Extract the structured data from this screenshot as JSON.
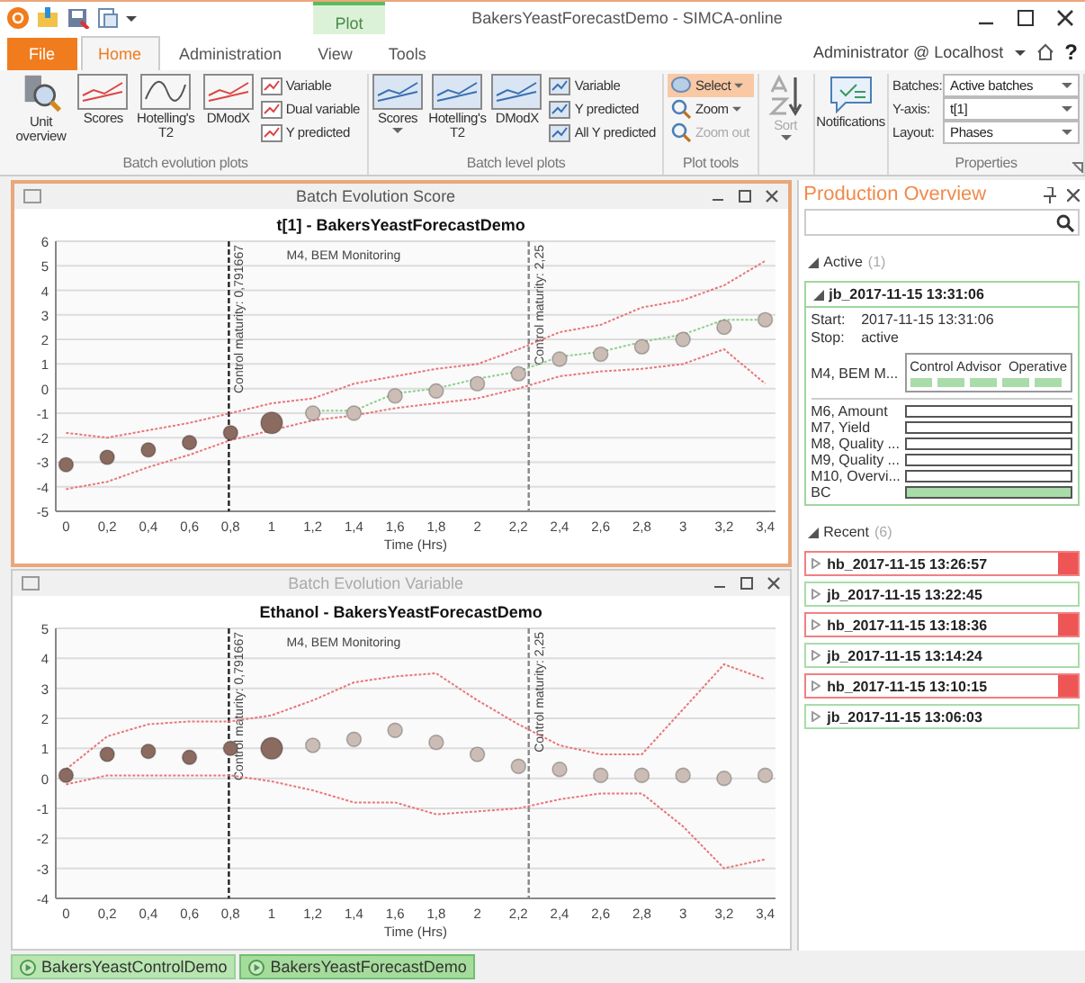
{
  "window": {
    "title": "BakersYeastForecastDemo - SIMCA-online",
    "context_tab": "Plot"
  },
  "tabs": [
    {
      "label": "File",
      "kind": "file",
      "selected": false
    },
    {
      "label": "Home",
      "kind": "tab",
      "selected": true
    },
    {
      "label": "Administration",
      "kind": "tab",
      "selected": false
    },
    {
      "label": "View",
      "kind": "tab",
      "selected": false
    },
    {
      "label": "Tools",
      "kind": "tab",
      "selected": false
    }
  ],
  "user": "Administrator @ Localhost",
  "help": "?",
  "ribbon": [
    {
      "label": "Batch evolution plots",
      "items": [
        {
          "kind": "large",
          "label": "Unit overview"
        },
        {
          "kind": "large",
          "label": "Scores"
        },
        {
          "kind": "large",
          "label": "Hotelling's T2"
        },
        {
          "kind": "large",
          "label": "DModX"
        },
        {
          "kind": "small",
          "label": "Variable"
        },
        {
          "kind": "small",
          "label": "Dual variable"
        },
        {
          "kind": "small",
          "label": "Y predicted"
        }
      ]
    },
    {
      "label": "Batch level plots",
      "items": [
        {
          "kind": "large",
          "label": "Scores",
          "dropdown": true
        },
        {
          "kind": "large",
          "label": "Hotelling's T2"
        },
        {
          "kind": "large",
          "label": "DModX"
        },
        {
          "kind": "small",
          "label": "Variable"
        },
        {
          "kind": "small",
          "label": "Y predicted"
        },
        {
          "kind": "small",
          "label": "All Y predicted"
        }
      ]
    },
    {
      "label": "Plot tools",
      "items": [
        {
          "kind": "small",
          "label": "Select",
          "dropdown": true,
          "selected": true,
          "disabled": false
        },
        {
          "kind": "small",
          "label": "Zoom",
          "dropdown": true,
          "selected": false,
          "disabled": false
        },
        {
          "kind": "small",
          "label": "Zoom out",
          "selected": false,
          "disabled": true
        }
      ]
    },
    {
      "items": [
        {
          "kind": "large",
          "label": "Sort",
          "dropdown": true,
          "disabled": true
        }
      ]
    },
    {
      "items": [
        {
          "kind": "large",
          "label": "Notifications"
        }
      ]
    },
    {
      "label": "Properties",
      "items": [
        {
          "kind": "field",
          "label": "Batches:",
          "value": "Active batches"
        },
        {
          "kind": "field",
          "label": "Y-axis:",
          "value": "t[1]"
        },
        {
          "kind": "field",
          "label": "Layout:",
          "value": "Phases"
        }
      ]
    }
  ],
  "panels": [
    {
      "title": "Batch Evolution Score",
      "active": true,
      "chart_data": {
        "type": "line",
        "title": "t[1] - BakersYeastForecastDemo",
        "xlabel": "Time (Hrs)",
        "x": [
          0,
          0.2,
          0.4,
          0.6,
          0.8,
          1,
          1.2,
          1.4,
          1.6,
          1.8,
          2,
          2.2,
          2.4,
          2.6,
          2.8,
          3,
          3.2,
          3.4
        ],
        "series": [
          {
            "type": "line",
            "line_style": "dotted",
            "color": "#e8767a",
            "values": [
              -1.8,
              -2,
              -1.7,
              -1.4,
              -1,
              -0.6,
              -0.4,
              0.2,
              0.5,
              0.8,
              1,
              1.6,
              2.3,
              2.6,
              3.3,
              3.6,
              4.2,
              5.2
            ]
          },
          {
            "type": "line",
            "line_style": "dotted",
            "color": "#e8767a",
            "values": [
              -4.1,
              -3.8,
              -3.2,
              -2.7,
              -2.1,
              -1.7,
              -1.3,
              -1.1,
              -0.8,
              -0.6,
              -0.4,
              0,
              0.5,
              0.7,
              0.8,
              1,
              1.6,
              0.2
            ]
          },
          {
            "type": "line",
            "line_style": "dotted",
            "color": "#8fd08f",
            "values": [
              null,
              null,
              null,
              null,
              null,
              null,
              -0.9,
              -0.9,
              -0.2,
              0,
              0.4,
              0.7,
              1.3,
              1.5,
              1.9,
              2.2,
              2.8,
              2.8
            ]
          },
          {
            "type": "scatter",
            "color": "#8b6a60",
            "values": [
              -3.1,
              -2.8,
              -2.5,
              -2.2,
              -1.8,
              null,
              null,
              null,
              null,
              null,
              null,
              null,
              null,
              null,
              null,
              null,
              null,
              null
            ]
          },
          {
            "type": "scatter",
            "color": "#8b6a60",
            "values": [
              null,
              null,
              null,
              null,
              null,
              -1.4,
              null,
              null,
              null,
              null,
              null,
              null,
              null,
              null,
              null,
              null,
              null,
              null
            ]
          },
          {
            "type": "scatter",
            "color": "#cbbdb5",
            "values": [
              null,
              null,
              null,
              null,
              null,
              null,
              -1,
              -1,
              -0.3,
              -0.1,
              0.2,
              0.6,
              1.2,
              1.4,
              1.7,
              2,
              2.5,
              2.8
            ]
          }
        ],
        "xlim": [
          -0.05,
          3.45
        ],
        "ylim": [
          -5,
          6
        ],
        "grid": true,
        "xticks": [
          0,
          {
            "value": 0.2,
            "label": "0,2"
          },
          {
            "value": 0.4,
            "label": "0,4"
          },
          {
            "value": 0.6,
            "label": "0,6"
          },
          {
            "value": 0.8,
            "label": "0,8"
          },
          1,
          {
            "value": 1.2,
            "label": "1,2"
          },
          {
            "value": 1.4,
            "label": "1,4"
          },
          {
            "value": 1.6,
            "label": "1,6"
          },
          {
            "value": 1.8,
            "label": "1,8"
          },
          2,
          {
            "value": 2.2,
            "label": "2,2"
          },
          {
            "value": 2.4,
            "label": "2,4"
          },
          {
            "value": 2.6,
            "label": "2,6"
          },
          {
            "value": 2.8,
            "label": "2,8"
          },
          3,
          {
            "value": 3.2,
            "label": "3,2"
          },
          {
            "value": 3.4,
            "label": "3,4"
          }
        ],
        "yticks": [
          -5,
          -4,
          -3,
          -2,
          -1,
          0,
          1,
          2,
          3,
          4,
          5,
          6
        ],
        "ref_lines": [
          {
            "axis": "x",
            "value": 0.791667,
            "label": "Control maturity: 0,791667",
            "color": "#222222",
            "line_style": "dashed"
          },
          {
            "axis": "x",
            "value": 2.25,
            "label": "Control maturity: 2,25",
            "color": "#888888",
            "line_style": "dashed"
          }
        ],
        "annotations": [
          "M4, BEM Monitoring"
        ]
      }
    },
    {
      "title": "Batch Evolution Variable",
      "active": false,
      "chart_data": {
        "type": "line",
        "title": "Ethanol - BakersYeastForecastDemo",
        "xlabel": "Time (Hrs)",
        "x": [
          0,
          0.2,
          0.4,
          0.6,
          0.8,
          1,
          1.2,
          1.4,
          1.6,
          1.8,
          2,
          2.2,
          2.4,
          2.6,
          2.8,
          3,
          3.2,
          3.4
        ],
        "series": [
          {
            "type": "line",
            "line_style": "dotted",
            "color": "#e8767a",
            "values": [
              0.3,
              1.4,
              1.8,
              1.9,
              1.9,
              2.1,
              2.6,
              3.2,
              3.4,
              3.5,
              2.6,
              1.8,
              1.1,
              0.8,
              0.8,
              2.3,
              3.8,
              3.3
            ]
          },
          {
            "type": "line",
            "line_style": "dotted",
            "color": "#e8767a",
            "values": [
              -0.2,
              0.1,
              0.1,
              0.1,
              0.1,
              -0.1,
              -0.4,
              -0.8,
              -0.8,
              -1.2,
              -1.1,
              -1,
              -0.7,
              -0.5,
              -0.5,
              -1.6,
              -3,
              -2.7
            ]
          },
          {
            "type": "scatter",
            "color": "#8b6a60",
            "values": [
              0.1,
              0.8,
              0.9,
              0.7,
              1,
              null,
              null,
              null,
              null,
              null,
              null,
              null,
              null,
              null,
              null,
              null,
              null,
              null
            ]
          },
          {
            "type": "scatter",
            "color": "#8b6a60",
            "values": [
              null,
              null,
              null,
              null,
              null,
              1,
              null,
              null,
              null,
              null,
              null,
              null,
              null,
              null,
              null,
              null,
              null,
              null
            ]
          },
          {
            "type": "scatter",
            "color": "#cbbdb5",
            "values": [
              null,
              null,
              null,
              null,
              null,
              null,
              1.1,
              1.3,
              1.6,
              1.2,
              0.8,
              0.4,
              0.3,
              0.1,
              0.1,
              0.1,
              0,
              0.1
            ]
          }
        ],
        "xlim": [
          -0.05,
          3.45
        ],
        "ylim": [
          -4,
          5
        ],
        "grid": true,
        "xticks": [
          0,
          {
            "value": 0.2,
            "label": "0,2"
          },
          {
            "value": 0.4,
            "label": "0,4"
          },
          {
            "value": 0.6,
            "label": "0,6"
          },
          {
            "value": 0.8,
            "label": "0,8"
          },
          1,
          {
            "value": 1.2,
            "label": "1,2"
          },
          {
            "value": 1.4,
            "label": "1,4"
          },
          {
            "value": 1.6,
            "label": "1,6"
          },
          {
            "value": 1.8,
            "label": "1,8"
          },
          2,
          {
            "value": 2.2,
            "label": "2,2"
          },
          {
            "value": 2.4,
            "label": "2,4"
          },
          {
            "value": 2.6,
            "label": "2,6"
          },
          {
            "value": 2.8,
            "label": "2,8"
          },
          3,
          {
            "value": 3.2,
            "label": "3,2"
          },
          {
            "value": 3.4,
            "label": "3,4"
          }
        ],
        "yticks": [
          -4,
          -3,
          -2,
          -1,
          0,
          1,
          2,
          3,
          4,
          5
        ],
        "ref_lines": [
          {
            "axis": "x",
            "value": 0.791667,
            "label": "Control maturity: 0,791667",
            "color": "#222222",
            "line_style": "dashed"
          },
          {
            "axis": "x",
            "value": 2.25,
            "label": "Control maturity: 2,25",
            "color": "#888888",
            "line_style": "dashed"
          }
        ],
        "annotations": [
          "M4, BEM Monitoring"
        ]
      }
    }
  ],
  "overview": {
    "title": "Production Overview",
    "active": {
      "label": "Active",
      "count": "(1)",
      "expanded": true,
      "batches": [
        {
          "name": "jb_2017-11-15 13:31:06",
          "expanded": true,
          "start_label": "Start:",
          "start": "2017-11-15 13:31:06",
          "stop_label": "Stop:",
          "stop": "active",
          "advisor": {
            "model": "M4, BEM M...",
            "label": "Control Advisor",
            "state": "Operative"
          },
          "models": [
            {
              "name": "M6, Amount",
              "filled": false
            },
            {
              "name": "M7, Yield",
              "filled": false
            },
            {
              "name": "M8, Quality ...",
              "filled": false
            },
            {
              "name": "M9, Quality ...",
              "filled": false
            },
            {
              "name": "M10, Overvi...",
              "filled": false
            },
            {
              "name": "BC",
              "filled": true
            }
          ]
        }
      ]
    },
    "recent": {
      "label": "Recent",
      "count": "(6)",
      "expanded": true,
      "batches": [
        {
          "name": "hb_2017-11-15 13:26:57",
          "color": "#f08080",
          "alarm": true
        },
        {
          "name": "jb_2017-11-15 13:22:45",
          "color": "#a8dca8",
          "alarm": false
        },
        {
          "name": "hb_2017-11-15 13:18:36",
          "color": "#f08080",
          "alarm": true
        },
        {
          "name": "jb_2017-11-15 13:14:24",
          "color": "#a8dca8",
          "alarm": false
        },
        {
          "name": "hb_2017-11-15 13:10:15",
          "color": "#f08080",
          "alarm": true
        },
        {
          "name": "jb_2017-11-15 13:06:03",
          "color": "#a8dca8",
          "alarm": false
        }
      ]
    }
  },
  "documents": [
    {
      "label": "BakersYeastControlDemo",
      "selected": false
    },
    {
      "label": "BakersYeastForecastDemo",
      "selected": true
    }
  ]
}
